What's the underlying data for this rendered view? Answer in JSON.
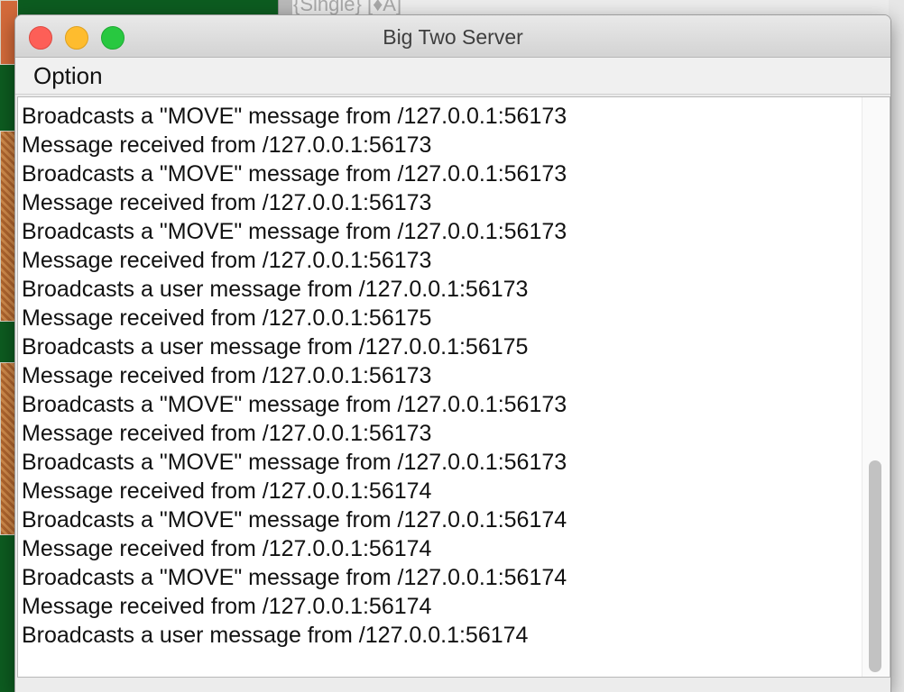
{
  "background": {
    "visible_text": "{Single} [♦A]"
  },
  "window": {
    "title": "Big Two Server",
    "controls": [
      "close",
      "minimize",
      "zoom"
    ]
  },
  "menubar": {
    "items": [
      "Option"
    ]
  },
  "log": {
    "lines": [
      "Broadcasts a \"MOVE\" message from /127.0.0.1:56173",
      "Message received from /127.0.0.1:56173",
      "Broadcasts a \"MOVE\" message from /127.0.0.1:56173",
      "Message received from /127.0.0.1:56173",
      "Broadcasts a \"MOVE\" message from /127.0.0.1:56173",
      "Message received from /127.0.0.1:56173",
      "Broadcasts a user message from /127.0.0.1:56173",
      "Message received from /127.0.0.1:56175",
      "Broadcasts a user message from /127.0.0.1:56175",
      "Message received from /127.0.0.1:56173",
      "Broadcasts a \"MOVE\" message from /127.0.0.1:56173",
      "Message received from /127.0.0.1:56173",
      "Broadcasts a \"MOVE\" message from /127.0.0.1:56173",
      "Message received from /127.0.0.1:56174",
      "Broadcasts a \"MOVE\" message from /127.0.0.1:56174",
      "Message received from /127.0.0.1:56174",
      "Broadcasts a \"MOVE\" message from /127.0.0.1:56174",
      "Message received from /127.0.0.1:56174",
      "Broadcasts a user message from /127.0.0.1:56174"
    ]
  },
  "scrollbar": {
    "position": 0.72,
    "visible_fraction": 0.37
  },
  "colors": {
    "close": "#fd5f57",
    "minimize": "#febc2e",
    "zoom": "#28c840",
    "table_green": "#0d5c20"
  }
}
